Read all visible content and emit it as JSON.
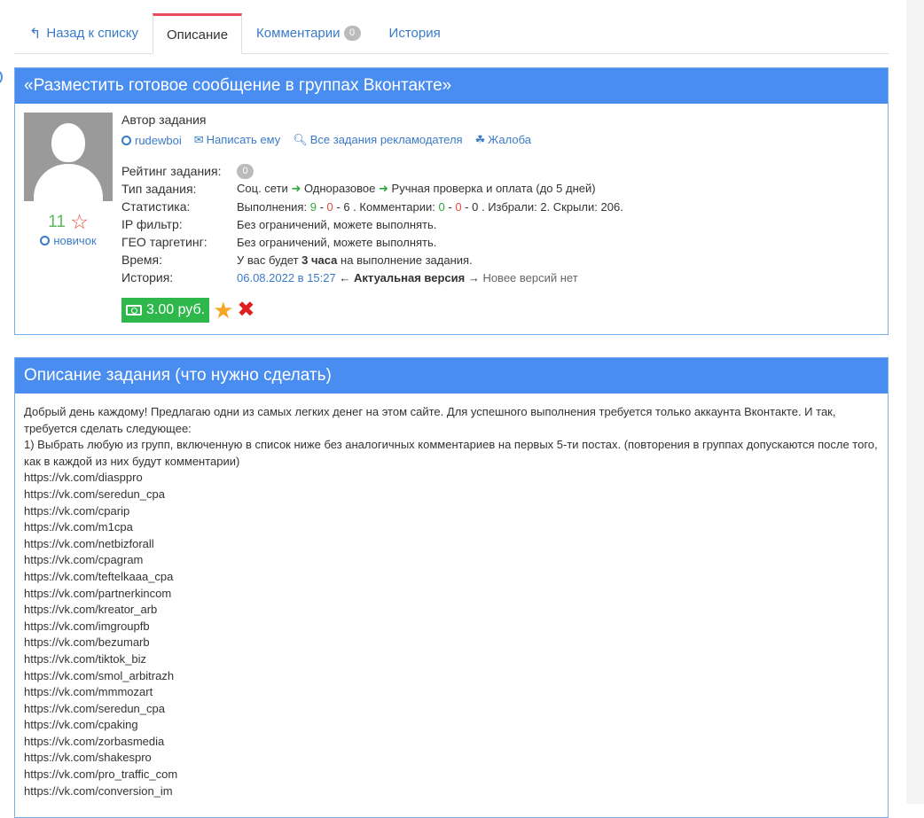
{
  "tabs": [
    {
      "label": "Назад к списку"
    },
    {
      "label": "Описание"
    },
    {
      "label": "Комментарии",
      "badge": "0"
    },
    {
      "label": "История"
    }
  ],
  "task": {
    "title": "«Разместить готовое сообщение в группах Вконтакте»",
    "author_label": "Автор задания",
    "author_links": {
      "username": "rudewboi",
      "message": "Написать ему",
      "all_tasks": "Все задания рекламодателя",
      "complaint": "Жалоба"
    },
    "author_rating": "11",
    "author_rank": "новичок",
    "rows": {
      "rating_label": "Рейтинг задания:",
      "rating_value": "0",
      "type_label": "Тип задания:",
      "type_1": "Соц. сети",
      "type_2": "Одноразовое",
      "type_3": "Ручная проверка и оплата (до 5 дней)",
      "stats_label": "Статистика:",
      "stats_exec_label": "Выполнения:",
      "stats_exec": [
        "9",
        "0",
        "6"
      ],
      "stats_comments_label": ". Комментарии:",
      "stats_comments": [
        "0",
        "0",
        "0"
      ],
      "stats_rest": ". Избрали: 2. Скрыли: 206.",
      "ip_label": "IP фильтр:",
      "ip_value": "Без ограничений, можете выполнять.",
      "geo_label": "ГЕО таргетинг:",
      "geo_value": "Без ограничений, можете выполнять.",
      "time_label": "Время:",
      "time_pre": "У вас будет",
      "time_bold": "3 часа",
      "time_post": "на выполнение задания.",
      "history_label": "История:",
      "history_date": "06.08.2022 в 15:27",
      "history_current": "Актуальная версия",
      "history_new": "Новее версий нет"
    },
    "price": "3.00 руб."
  },
  "description": {
    "title": "Описание задания (что нужно сделать)",
    "intro": "Добрый день каждому! Предлагаю одни из самых легких денег на этом сайте. Для успешного выполнения требуется только аккаунта Вконтакте. И так, требуется сделать следующее:",
    "step1": "1) Выбрать любую из групп, включенную в список ниже без аналогичных комментариев на первых 5-ти постах. (повторения в группах допускаются после того, как в каждой из них будут комментарии)",
    "links": [
      "https://vk.com/diasppro",
      "https://vk.com/seredun_cpa",
      "https://vk.com/cparip",
      "https://vk.com/m1cpa",
      "https://vk.com/netbizforall",
      "https://vk.com/cpagram",
      "https://vk.com/teftelkaaa_cpa",
      "https://vk.com/partnerkincom",
      "https://vk.com/kreator_arb",
      "https://vk.com/imgroupfb",
      "https://vk.com/bezumarb",
      "https://vk.com/tiktok_biz",
      "https://vk.com/smol_arbitrazh",
      "https://vk.com/mmmozart",
      "https://vk.com/seredun_cpa",
      "https://vk.com/cpaking",
      "https://vk.com/zorbasmedia",
      "https://vk.com/shakespro",
      "https://vk.com/pro_traffic_com",
      "https://vk.com/conversion_im"
    ]
  },
  "colors": {
    "header_blue": "#4a8df0",
    "active_tab_accent": "#e74c5a",
    "price_green": "#2eb84b",
    "link_blue": "#3a7bc8"
  }
}
